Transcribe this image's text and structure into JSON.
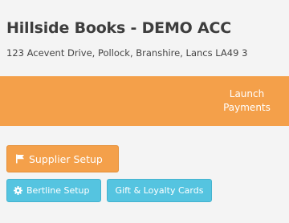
{
  "header": {
    "store_name": "Hillside Books - DEMO ACC",
    "store_address": "123 Acevent Drive, Pollock, Branshire, Lancs  LA49 3"
  },
  "nav": {
    "launch_line1": "Launch",
    "launch_line2": "Payments"
  },
  "buttons": {
    "supplier_setup": "Supplier Setup",
    "bertline_setup": "Bertline Setup",
    "gift_loyalty": "Gift & Loyalty Cards"
  },
  "icons": {
    "supplier_setup": "flag-icon",
    "bertline_setup": "gear-icon"
  },
  "colors": {
    "accent_orange": "#f4a04a",
    "accent_blue": "#55c4e0",
    "title_text": "#3d3d3d"
  }
}
